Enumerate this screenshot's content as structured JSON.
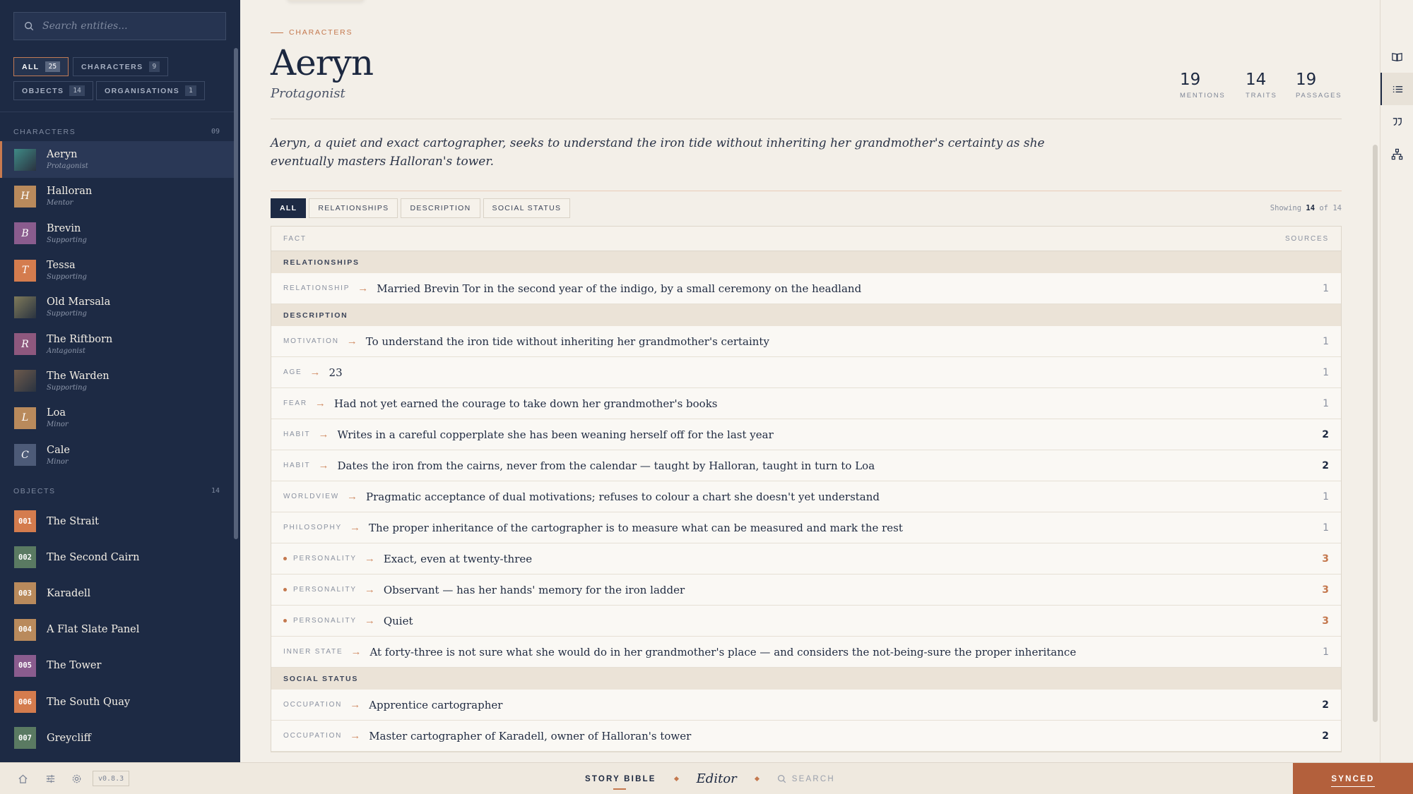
{
  "sidebar": {
    "search_placeholder": "Search entities...",
    "filters": [
      {
        "label": "ALL",
        "count": "25"
      },
      {
        "label": "CHARACTERS",
        "count": "9"
      },
      {
        "label": "OBJECTS",
        "count": "14"
      },
      {
        "label": "ORGANISATIONS",
        "count": "1"
      }
    ],
    "characters_heading": "CHARACTERS",
    "characters_count": "09",
    "characters": [
      {
        "name": "Aeryn",
        "role": "Protagonist",
        "initial": "",
        "color": "#3f8a86"
      },
      {
        "name": "Halloran",
        "role": "Mentor",
        "initial": "H",
        "color": "#b98a5c"
      },
      {
        "name": "Brevin",
        "role": "Supporting",
        "initial": "B",
        "color": "#8a5c8e"
      },
      {
        "name": "Tessa",
        "role": "Supporting",
        "initial": "T",
        "color": "#d47c4e"
      },
      {
        "name": "Old Marsala",
        "role": "Supporting",
        "initial": "",
        "color": "#7f7a5a"
      },
      {
        "name": "The Riftborn",
        "role": "Antagonist",
        "initial": "R",
        "color": "#8e587e"
      },
      {
        "name": "The Warden",
        "role": "Supporting",
        "initial": "",
        "color": "#6d5a4c"
      },
      {
        "name": "Loa",
        "role": "Minor",
        "initial": "L",
        "color": "#b98a5c"
      },
      {
        "name": "Cale",
        "role": "Minor",
        "initial": "C",
        "color": "#4d5b78"
      }
    ],
    "objects_heading": "OBJECTS",
    "objects_count": "14",
    "objects": [
      {
        "num": "001",
        "name": "The Strait",
        "color": "#d47c4e"
      },
      {
        "num": "002",
        "name": "The Second Cairn",
        "color": "#5a7a62"
      },
      {
        "num": "003",
        "name": "Karadell",
        "color": "#b98a5c"
      },
      {
        "num": "004",
        "name": "A Flat Slate Panel",
        "color": "#b98a5c"
      },
      {
        "num": "005",
        "name": "The Tower",
        "color": "#8a5c8e"
      },
      {
        "num": "006",
        "name": "The South Quay",
        "color": "#d47c4e"
      },
      {
        "num": "007",
        "name": "Greycliff",
        "color": "#5a7a62"
      }
    ]
  },
  "entity": {
    "crumb": "CHARACTERS",
    "name": "Aeryn",
    "role": "Protagonist",
    "summary": "Aeryn, a quiet and exact cartographer, seeks to understand the iron tide without inheriting her grandmother's certainty as she eventually masters Halloran's tower.",
    "stats": [
      {
        "value": "19",
        "label": "MENTIONS"
      },
      {
        "value": "14",
        "label": "TRAITS"
      },
      {
        "value": "19",
        "label": "PASSAGES"
      }
    ]
  },
  "tabs": [
    "ALL",
    "RELATIONSHIPS",
    "DESCRIPTION",
    "SOCIAL STATUS"
  ],
  "showing": {
    "prefix": "Showing",
    "shown": "14",
    "of": "of",
    "total": "14"
  },
  "table": {
    "col_fact": "FACT",
    "col_sources": "SOURCES",
    "groups": [
      {
        "title": "RELATIONSHIPS",
        "rows": [
          {
            "label": "RELATIONSHIP",
            "fact": "Married Brevin Tor in the second year of the indigo, by a small ceremony on the headland",
            "sources": "1",
            "style": "n",
            "dot": false
          }
        ]
      },
      {
        "title": "DESCRIPTION",
        "rows": [
          {
            "label": "MOTIVATION",
            "fact": "To understand the iron tide without inheriting her grandmother's certainty",
            "sources": "1",
            "style": "n",
            "dot": false
          },
          {
            "label": "AGE",
            "fact": "23",
            "sources": "1",
            "style": "n",
            "dot": false
          },
          {
            "label": "FEAR",
            "fact": "Had not yet earned the courage to take down her grandmother's books",
            "sources": "1",
            "style": "n",
            "dot": false
          },
          {
            "label": "HABIT",
            "fact": "Writes in a careful copperplate she has been weaning herself off for the last year",
            "sources": "2",
            "style": "b",
            "dot": false
          },
          {
            "label": "HABIT",
            "fact": "Dates the iron from the cairns, never from the calendar — taught by Halloran, taught in turn to Loa",
            "sources": "2",
            "style": "b",
            "dot": false
          },
          {
            "label": "WORLDVIEW",
            "fact": "Pragmatic acceptance of dual motivations; refuses to colour a chart she doesn't yet understand",
            "sources": "1",
            "style": "n",
            "dot": false
          },
          {
            "label": "PHILOSOPHY",
            "fact": "The proper inheritance of the cartographer is to measure what can be measured and mark the rest",
            "sources": "1",
            "style": "n",
            "dot": false
          },
          {
            "label": "PERSONALITY",
            "fact": "Exact, even at twenty-three",
            "sources": "3",
            "style": "o",
            "dot": true
          },
          {
            "label": "PERSONALITY",
            "fact": "Observant — has her hands' memory for the iron ladder",
            "sources": "3",
            "style": "o",
            "dot": true
          },
          {
            "label": "PERSONALITY",
            "fact": "Quiet",
            "sources": "3",
            "style": "o",
            "dot": true
          },
          {
            "label": "INNER STATE",
            "fact": "At forty-three is not sure what she would do in her grandmother's place — and considers the not-being-sure the proper inheritance",
            "sources": "1",
            "style": "n",
            "dot": false
          }
        ]
      },
      {
        "title": "SOCIAL STATUS",
        "rows": [
          {
            "label": "OCCUPATION",
            "fact": "Apprentice cartographer",
            "sources": "2",
            "style": "b",
            "dot": false
          },
          {
            "label": "OCCUPATION",
            "fact": "Master cartographer of Karadell, owner of Halloran's tower",
            "sources": "2",
            "style": "b",
            "dot": false
          }
        ]
      }
    ]
  },
  "bottombar": {
    "version": "v0.8.3",
    "story_bible": "STORY BIBLE",
    "editor": "Editor",
    "search": "SEARCH",
    "synced": "SYNCED"
  },
  "colors": {
    "accent": "#c4784e",
    "navy": "#1d2a44",
    "synced": "#b3603c"
  }
}
